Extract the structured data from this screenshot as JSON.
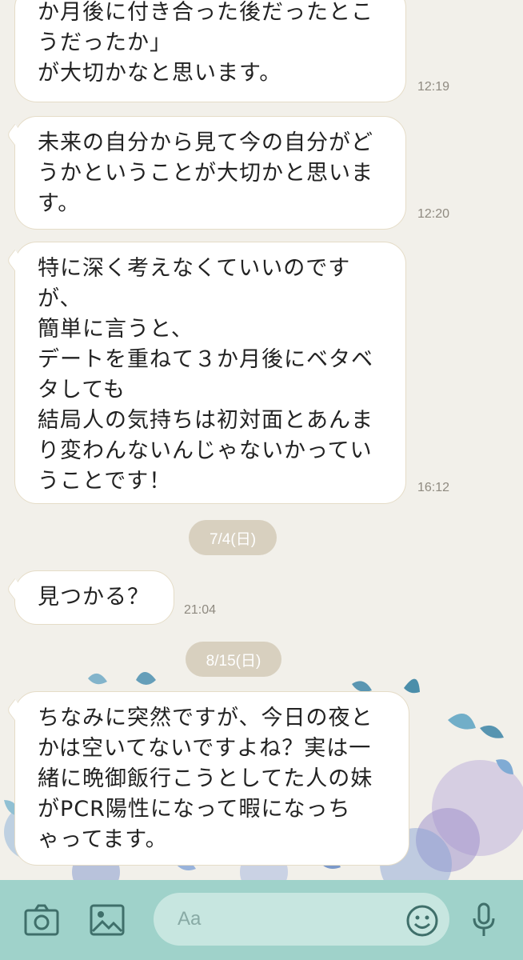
{
  "messages": [
    {
      "text": "か月後に付き合った後だったとこ\nうだったか」\nが大切かなと思います。",
      "time": "12:19"
    },
    {
      "text": "未来の自分から見て今の自分がど\nうかということが大切かと思いま\nす。",
      "time": "12:20"
    },
    {
      "text": "特に深く考えなくていいのです\nが、\n簡単に言うと、\nデートを重ねて３か月後にベタベ\nタしても\n結局人の気持ちは初対面とあんま\nり変わんないんじゃないかってい\nうことです！",
      "time": "16:12"
    },
    {
      "text": "見つかる？",
      "time": "21:04"
    },
    {
      "text": "ちなみに突然ですが、今日の夜と\nかは空いてないですよね？実は一\n緒に晩御飯行こうとしてた人の妹\nがPCR陽性になって暇になっち\nゃってます。",
      "time": ""
    }
  ],
  "dates": [
    "7/4(日)",
    "8/15(日)"
  ],
  "input": {
    "placeholder": "Aa"
  },
  "icons": [
    "camera-icon",
    "image-icon",
    "emoji-icon",
    "mic-icon"
  ],
  "colors": {
    "background": "#f2f0ea",
    "bubble_border": "#e5dcc7",
    "bottom_bar": "#9fd2ca",
    "date_pill": "#d8d0bf"
  }
}
